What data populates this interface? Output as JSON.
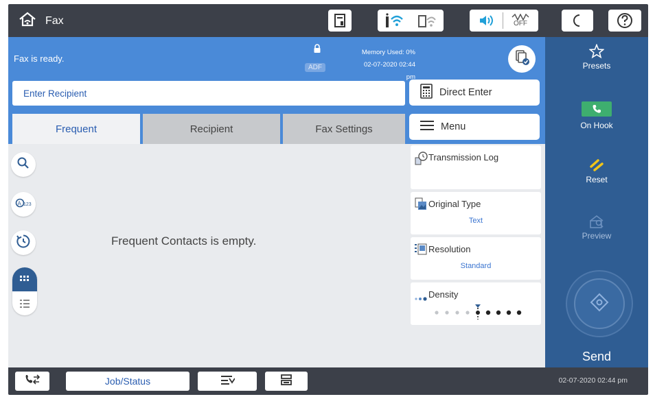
{
  "header": {
    "title": "Fax",
    "home_icon": "home-icon",
    "status_icons": [
      "printer-status-icon",
      "wifi-icon",
      "wifi-direct-icon",
      "volume-icon",
      "eco-off-icon",
      "sleep-icon",
      "help-icon"
    ],
    "eco_label": "OFF"
  },
  "status": {
    "ready_text": "Fax is ready.",
    "adf_label": "ADF",
    "memory_text": "Memory Used: 0%",
    "datetime": "02-07-2020 02:44 pm"
  },
  "recipient": {
    "placeholder": "Enter Recipient"
  },
  "buttons": {
    "direct_enter": "Direct Enter",
    "menu": "Menu"
  },
  "tabs": [
    {
      "label": "Frequent",
      "active": true
    },
    {
      "label": "Recipient",
      "active": false
    },
    {
      "label": "Fax Settings",
      "active": false
    }
  ],
  "main": {
    "empty_message": "Frequent Contacts is empty."
  },
  "settings": {
    "transmission_log": "Transmission Log",
    "original_type": {
      "label": "Original Type",
      "value": "Text"
    },
    "resolution": {
      "label": "Resolution",
      "value": "Standard"
    },
    "density": {
      "label": "Density",
      "level_index": 4,
      "levels": 9
    }
  },
  "sidebar": {
    "presets": "Presets",
    "on_hook": "On Hook",
    "reset": "Reset",
    "preview": "Preview",
    "send": "Send"
  },
  "footer": {
    "job_status": "Job/Status",
    "datetime": "02-07-2020 02:44 pm"
  },
  "colors": {
    "topbar": "#3c4049",
    "status_blue": "#4a8ad8",
    "sidebar_blue": "#2f5d93",
    "on_hook_green": "#3eae6f",
    "reset_yellow": "#f0c419"
  }
}
